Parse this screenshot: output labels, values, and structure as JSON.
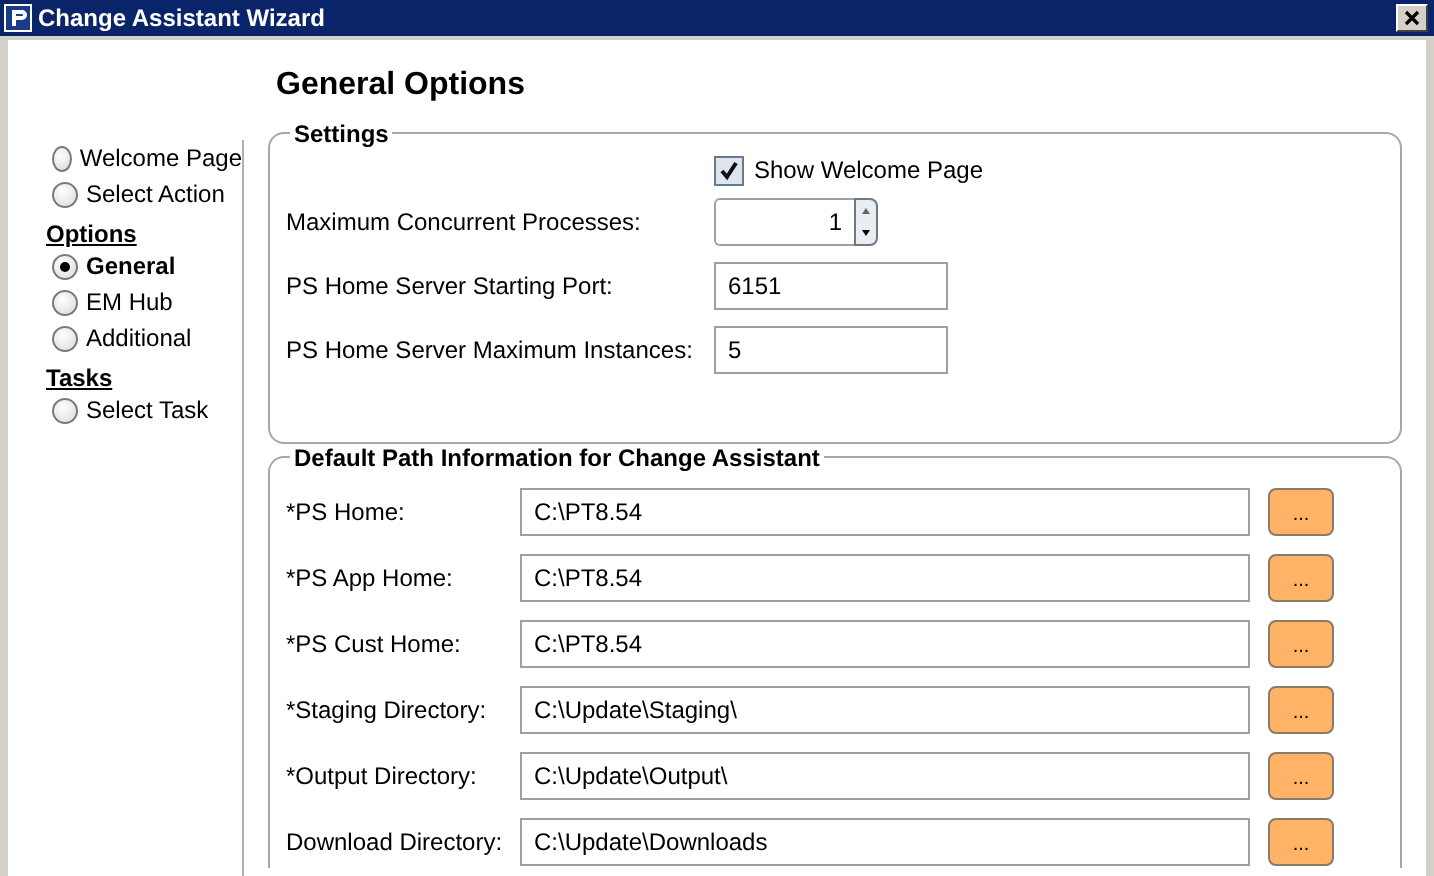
{
  "window": {
    "title": "Change Assistant Wizard"
  },
  "nav": [
    {
      "kind": "radio",
      "label": "Welcome Page",
      "selected": false
    },
    {
      "kind": "radio",
      "label": "Select Action",
      "selected": false
    },
    {
      "kind": "header",
      "label": "Options"
    },
    {
      "kind": "radio",
      "label": "General",
      "selected": true
    },
    {
      "kind": "radio",
      "label": "EM Hub",
      "selected": false
    },
    {
      "kind": "radio",
      "label": "Additional",
      "selected": false
    },
    {
      "kind": "header",
      "label": "Tasks"
    },
    {
      "kind": "radio",
      "label": "Select Task",
      "selected": false
    }
  ],
  "heading": "General Options",
  "settings": {
    "title": "Settings",
    "show_welcome": {
      "label": "Show Welcome Page",
      "checked": true
    },
    "fields": [
      {
        "kind": "spinner",
        "label": "Maximum Concurrent Processes:",
        "value": "1"
      },
      {
        "kind": "text",
        "label": "PS Home Server Starting Port:",
        "value": "6151"
      },
      {
        "kind": "text",
        "label": "PS Home Server Maximum Instances:",
        "value": "5"
      }
    ]
  },
  "paths": {
    "title": "Default Path Information for Change Assistant",
    "rows": [
      {
        "label": "*PS Home:",
        "value": "C:\\PT8.54",
        "button": "..."
      },
      {
        "label": "*PS App Home:",
        "value": "C:\\PT8.54",
        "button": "..."
      },
      {
        "label": "*PS Cust Home:",
        "value": "C:\\PT8.54",
        "button": "..."
      },
      {
        "label": "*Staging Directory:",
        "value": "C:\\Update\\Staging\\",
        "button": "..."
      },
      {
        "label": "*Output Directory:",
        "value": "C:\\Update\\Output\\",
        "button": "..."
      },
      {
        "label": "Download Directory:",
        "value": "C:\\Update\\Downloads",
        "button": "..."
      }
    ]
  }
}
